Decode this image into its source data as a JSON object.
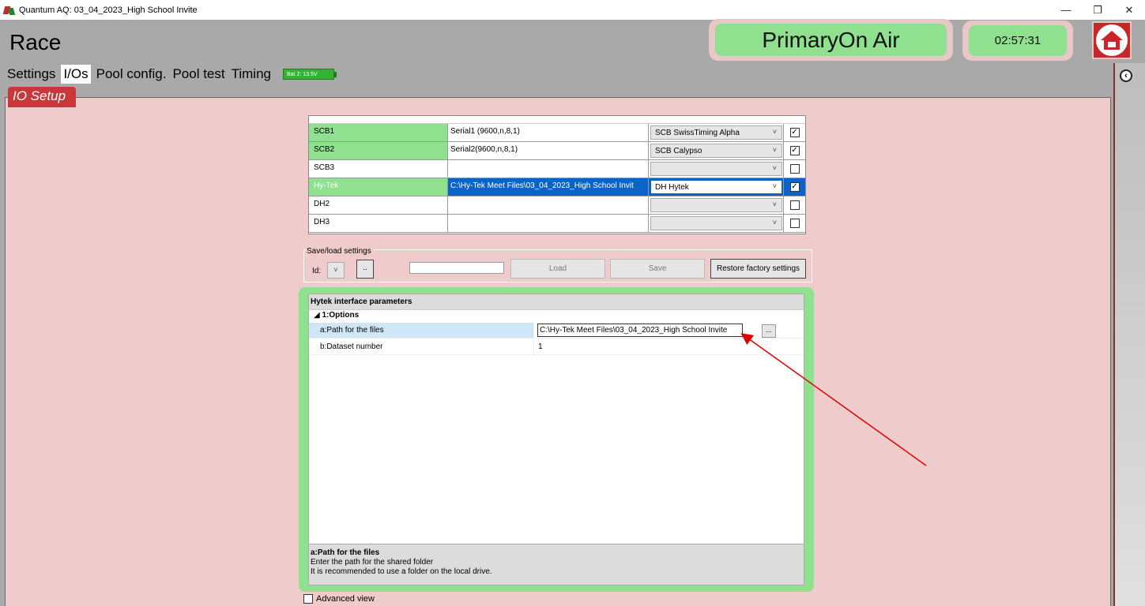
{
  "window": {
    "title": "Quantum AQ: 03_04_2023_High School Invite",
    "minimize": "—",
    "maximize": "❐",
    "close": "✕"
  },
  "header": {
    "app_title": "Race",
    "onair": "PrimaryOn Air",
    "clock": "02:57:31"
  },
  "tabs": [
    {
      "label": "Settings"
    },
    {
      "label": "I/Os",
      "active": true
    },
    {
      "label": "Pool config."
    },
    {
      "label": "Pool test"
    },
    {
      "label": "Timing"
    }
  ],
  "battery": {
    "label": "Bat 2: 13.5V"
  },
  "section": {
    "title": "IO Setup"
  },
  "io_rows": [
    {
      "name": "SCB1",
      "path": "Serial1 (9600,n,8,1)",
      "device": "SCB SwissTiming Alpha",
      "checked": true,
      "active": true
    },
    {
      "name": "SCB2",
      "path": "Serial2(9600,n,8,1)",
      "device": "SCB Calypso",
      "checked": true,
      "active": true
    },
    {
      "name": "SCB3",
      "path": "",
      "device": "",
      "checked": false,
      "active": false
    },
    {
      "name": "Hy-Tek",
      "path": "C:\\Hy-Tek Meet Files\\03_04_2023_High School Invit",
      "device": "DH Hytek",
      "checked": true,
      "active": true,
      "selected": true
    },
    {
      "name": "DH2",
      "path": "",
      "device": "",
      "checked": false,
      "active": false
    },
    {
      "name": "DH3",
      "path": "",
      "device": "",
      "checked": false,
      "active": false
    }
  ],
  "saveload": {
    "label": "Save/load settings",
    "id_label": "Id:",
    "combo_arrow": "˅",
    "dots": "..",
    "load": "Load",
    "save": "Save",
    "restore": "Restore factory settings"
  },
  "hytek": {
    "title": "Hytek interface parameters",
    "category": "◢  1:Options",
    "rows": [
      {
        "key": "a:Path for the files",
        "value": "C:\\Hy-Tek Meet Files\\03_04_2023_High School Invite",
        "browse": "..."
      },
      {
        "key": "b:Dataset number",
        "value": "1"
      }
    ],
    "desc_title": "a:Path for the files",
    "desc_line1": "Enter the path for the shared folder",
    "desc_line2": "It is recommended to use a folder on the local drive."
  },
  "advanced": {
    "label": "Advanced view",
    "checked": false
  },
  "colors": {
    "accent_green": "#8fe08f",
    "brand_red": "#c8383b",
    "panel_pink": "#efcbcb",
    "annotation_arrow": "#e00000"
  },
  "icons": {
    "home": "home-icon",
    "sidebar_toggle": "chevron-left-icon",
    "annotation": "arrow-icon"
  }
}
